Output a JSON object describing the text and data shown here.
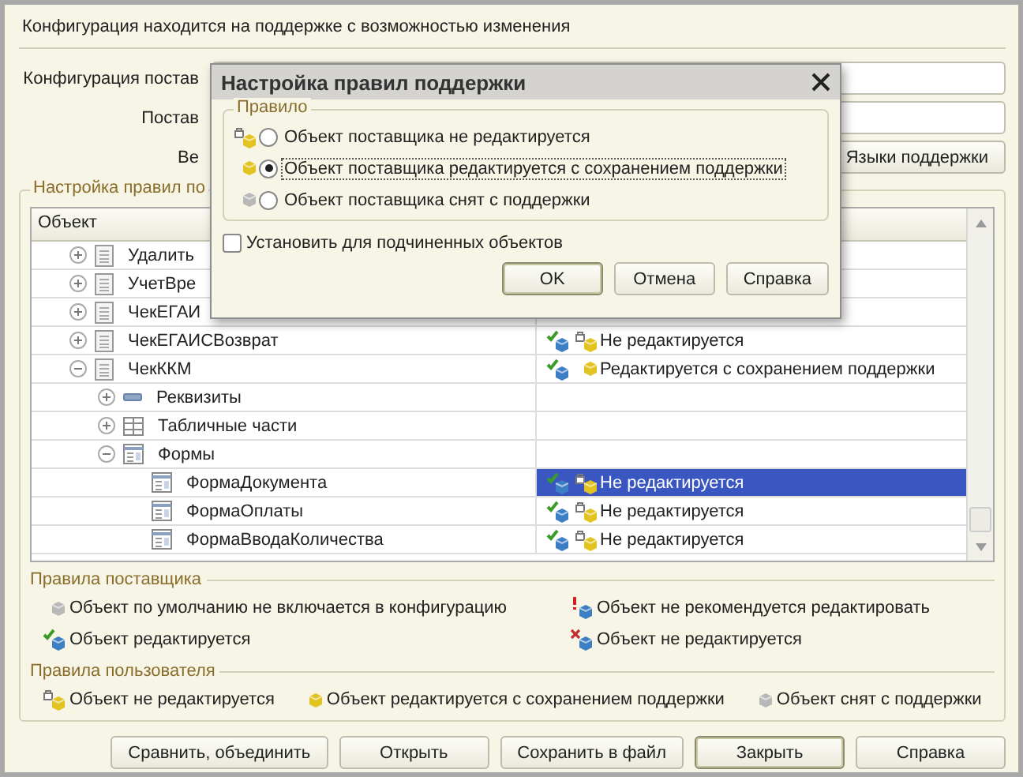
{
  "window": {
    "title": "Конфигурация находится на поддержке с возможностью изменения"
  },
  "info_rows": [
    {
      "label": "Конфигурация постав",
      "value": ""
    },
    {
      "label": "Постав",
      "value": ""
    },
    {
      "label": "Ве",
      "value": "",
      "button": "Языки поддержки"
    }
  ],
  "rules_group": {
    "title": "Настройка правил по"
  },
  "tree": {
    "columns": [
      "Объект"
    ],
    "rows": [
      {
        "label": "Удалить",
        "kind": "document",
        "expanded": false,
        "selected": false
      },
      {
        "label": "УчетВре",
        "kind": "document",
        "expanded": false,
        "selected": false
      },
      {
        "label": "ЧекЕГАИ",
        "kind": "document",
        "expanded": false,
        "selected": false
      },
      {
        "label": "ЧекЕГАИСВозврат",
        "kind": "document",
        "expanded": false,
        "selected": false,
        "status": {
          "text": "Не редактируется",
          "icons": [
            {
              "kind": "editable"
            },
            {
              "kind": "locked"
            }
          ]
        }
      },
      {
        "label": "ЧекККМ",
        "kind": "document",
        "expanded": true,
        "selected": false,
        "status": {
          "text": "Редактируется с сохранением поддержки",
          "icons": [
            {
              "kind": "editable"
            },
            {
              "kind": "supported"
            }
          ]
        },
        "children": [
          {
            "label": "Реквизиты",
            "kind": "attributes",
            "expanded": false,
            "selected": false
          },
          {
            "label": "Табличные части",
            "kind": "tables",
            "expanded": false,
            "selected": false
          },
          {
            "label": "Формы",
            "kind": "forms",
            "expanded": true,
            "selected": false,
            "children": [
              {
                "label": "ФормаДокумента",
                "kind": "forms",
                "selected": true,
                "status": {
                  "text": "Не редактируется",
                  "icons": [
                    {
                      "kind": "editable"
                    },
                    {
                      "kind": "locked"
                    }
                  ]
                }
              },
              {
                "label": "ФормаОплаты",
                "kind": "forms",
                "selected": false,
                "status": {
                  "text": "Не редактируется",
                  "icons": [
                    {
                      "kind": "editable"
                    },
                    {
                      "kind": "locked"
                    }
                  ]
                }
              },
              {
                "label": "ФормаВводаКоличества",
                "kind": "forms",
                "selected": false,
                "status": {
                  "text": "Не редактируется",
                  "icons": [
                    {
                      "kind": "editable"
                    },
                    {
                      "kind": "locked"
                    }
                  ]
                }
              }
            ]
          }
        ]
      }
    ]
  },
  "supplier_rules": {
    "title": "Правила поставщика",
    "items": [
      {
        "kind": "default_excluded",
        "label": "Объект по умолчанию не включается в конфигурацию"
      },
      {
        "kind": "not_recommended",
        "label": "Объект не рекомендуется редактировать"
      },
      {
        "kind": "editable",
        "label": "Объект редактируется"
      },
      {
        "kind": "not_editable",
        "label": "Объект не редактируется"
      }
    ]
  },
  "user_rules": {
    "title": "Правила пользователя",
    "items": [
      {
        "kind": "locked",
        "label": "Объект не редактируется"
      },
      {
        "kind": "supported",
        "label": "Объект редактируется с сохранением поддержки"
      },
      {
        "kind": "removed",
        "label": "Объект снят с поддержки"
      }
    ]
  },
  "buttons": [
    {
      "label": "Сравнить, объединить",
      "default": false
    },
    {
      "label": "Открыть",
      "default": false
    },
    {
      "label": "Сохранить в файл",
      "default": false
    },
    {
      "label": "Закрыть",
      "default": true
    },
    {
      "label": "Справка",
      "default": false
    }
  ],
  "dialog": {
    "title": "Настройка правил поддержки",
    "group": "Правило",
    "options": [
      {
        "kind": "locked",
        "label": "Объект поставщика не редактируется",
        "selected": false
      },
      {
        "kind": "supported",
        "label": "Объект поставщика редактируется с сохранением поддержки",
        "selected": true
      },
      {
        "kind": "removed",
        "label": "Объект поставщика снят с поддержки",
        "selected": false
      }
    ],
    "checkbox": {
      "label": "Установить для подчиненных объектов",
      "checked": false
    },
    "buttons": [
      {
        "label": "OK",
        "default": true
      },
      {
        "label": "Отмена",
        "default": false
      },
      {
        "label": "Справка",
        "default": false
      }
    ]
  }
}
